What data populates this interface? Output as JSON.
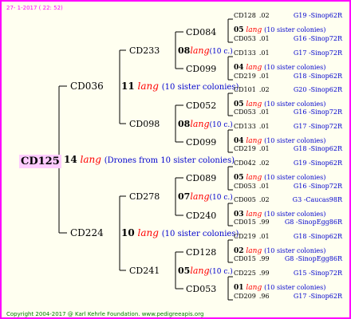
{
  "header": "27- 1-2017 ( 22: 52)",
  "footer": "Copyright 2004-2017 @ Karl Kehrle Foundation.   www.pedigreeapis.org",
  "root": {
    "code": "CD125",
    "count": "14",
    "lang": "lang",
    "note": "(Drones from 10 sister colonies)"
  },
  "gen1": [
    {
      "code": "CD036",
      "count": "11",
      "lang": "lang",
      "note": "(10 sister colonies)"
    },
    {
      "code": "CD224",
      "count": "10",
      "lang": "lang",
      "note": "(10 sister colonies)"
    }
  ],
  "gen2": [
    {
      "code": "CD233",
      "count": "08",
      "lang": "lang",
      "note": "(10 c.)"
    },
    {
      "code": "CD098",
      "count": "08",
      "lang": "lang",
      "note": "(10 c.)"
    },
    {
      "code": "CD278",
      "count": "07",
      "lang": "lang",
      "note": "(10 c.)"
    },
    {
      "code": "CD241",
      "count": "05",
      "lang": "lang",
      "note": "(10 c.)"
    }
  ],
  "gen3": [
    {
      "code": "CD084",
      "count": "05",
      "lang": "lang",
      "note": "(10 sister colonies)"
    },
    {
      "code": "CD099",
      "count": "04",
      "lang": "lang",
      "note": "(10 sister colonies)"
    },
    {
      "code": "CD052",
      "count": "05",
      "lang": "lang",
      "note": "(10 sister colonies)"
    },
    {
      "code": "CD099",
      "count": "04",
      "lang": "lang",
      "note": "(10 sister colonies)"
    },
    {
      "code": "CD089",
      "count": "05",
      "lang": "lang",
      "note": "(10 sister colonies)"
    },
    {
      "code": "CD240",
      "count": "03",
      "lang": "lang",
      "note": "(10 sister colonies)"
    },
    {
      "code": "CD128",
      "count": "02",
      "lang": "lang",
      "note": "(10 sister colonies)"
    },
    {
      "code": "CD053",
      "count": "01",
      "lang": "lang",
      "note": "(10 sister colonies)"
    }
  ],
  "gen4": [
    {
      "code": "CD128",
      "num": ".02",
      "sire": "G19 -Sinop62R"
    },
    {
      "code": "CD053",
      "num": ".01",
      "sire": "G16 -Sinop72R"
    },
    {
      "code": "CD133",
      "num": ".01",
      "sire": "G17 -Sinop72R"
    },
    {
      "code": "CD219",
      "num": ".01",
      "sire": "G18 -Sinop62R"
    },
    {
      "code": "CD101",
      "num": ".02",
      "sire": "G20 -Sinop62R"
    },
    {
      "code": "CD053",
      "num": ".01",
      "sire": "G16 -Sinop72R"
    },
    {
      "code": "CD133",
      "num": ".01",
      "sire": "G17 -Sinop72R"
    },
    {
      "code": "CD219",
      "num": ".01",
      "sire": "G18 -Sinop62R"
    },
    {
      "code": "CD042",
      "num": ".02",
      "sire": "G19 -Sinop62R"
    },
    {
      "code": "CD053",
      "num": ".01",
      "sire": "G16 -Sinop72R"
    },
    {
      "code": "CD005",
      "num": ".02",
      "sire": "G3 -Caucas98R"
    },
    {
      "code": "CD015",
      "num": ".99",
      "sire": "G8 -SinopEgg86R"
    },
    {
      "code": "CD219",
      "num": ".01",
      "sire": "G18 -Sinop62R"
    },
    {
      "code": "CD015",
      "num": ".99",
      "sire": "G8 -SinopEgg86R"
    },
    {
      "code": "CD225",
      "num": ".99",
      "sire": "G15 -Sinop72R"
    },
    {
      "code": "CD209",
      "num": ".96",
      "sire": "G17 -Sinop62R"
    }
  ]
}
